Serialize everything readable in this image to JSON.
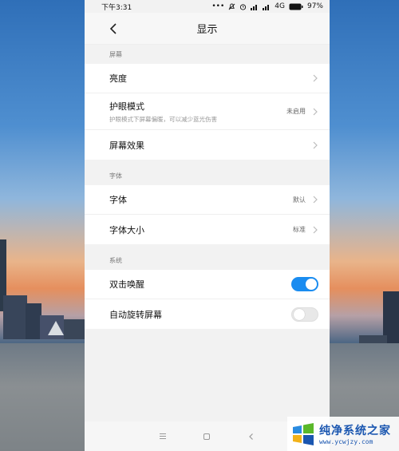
{
  "statusbar": {
    "time": "下午3:31",
    "indicators": "… ",
    "network": "4G",
    "battery": "97%"
  },
  "header": {
    "title": "显示"
  },
  "sections": [
    {
      "label": "屏幕",
      "items": [
        {
          "label": "亮度",
          "sub": "",
          "value": ""
        },
        {
          "label": "护眼模式",
          "sub": "护眼模式下屏幕偏暖，可以减少蓝光伤害",
          "value": "未启用"
        },
        {
          "label": "屏幕效果",
          "sub": "",
          "value": ""
        }
      ]
    },
    {
      "label": "字体",
      "items": [
        {
          "label": "字体",
          "value": "默认"
        },
        {
          "label": "字体大小",
          "value": "标准"
        }
      ]
    },
    {
      "label": "系统",
      "items": [
        {
          "label": "双击唤醒",
          "toggle_on": true
        },
        {
          "label": "自动旋转屏幕",
          "toggle_on": false
        }
      ]
    }
  ],
  "watermark": {
    "title": "纯净系统之家",
    "url": "www.ycwjzy.com"
  },
  "colors": {
    "accent": "#1a8cf0",
    "background": "#f2f2f2"
  }
}
